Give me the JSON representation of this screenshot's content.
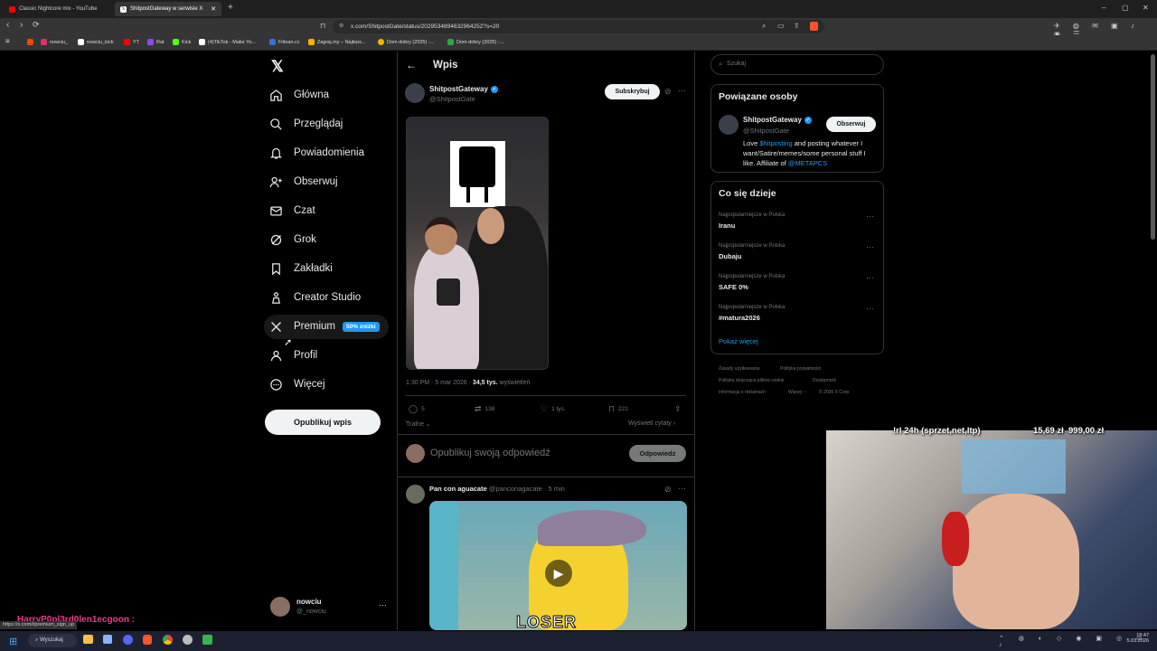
{
  "tabs": [
    {
      "title": "Classic Nightcore mix - YouTube",
      "color": "#ff0000"
    },
    {
      "title": "ShitpostGateway w serwisie X",
      "color": "#ffffff"
    }
  ],
  "new_tab": "+",
  "window": {
    "minimize": "–",
    "maximize": "▢",
    "close": "✕"
  },
  "address_bar": {
    "url": "x.com/ShitpostGate/status/2029534894632964252?s=20"
  },
  "bookmarks": [
    {
      "label": "",
      "color": "#ff4500"
    },
    {
      "label": "nowciu_",
      "color": "#e1306c"
    },
    {
      "label": "nowciu_kick",
      "color": "#ffffff"
    },
    {
      "label": "YT",
      "color": "#ff0000"
    },
    {
      "label": "Rat",
      "color": "#9146ff"
    },
    {
      "label": "Kick",
      "color": "#53fc18"
    },
    {
      "label": "(4)TikTok - Make Yo...",
      "color": "#ffffff"
    },
    {
      "label": "Filman.cc",
      "color": "#3b6fd9"
    },
    {
      "label": "Zagraj.my – Najleps...",
      "color": "#f2b500"
    },
    {
      "label": "Dom dobry (2025) -...",
      "color": "#f2b500"
    },
    {
      "label": "Dom dobry (2025) -...",
      "color": "#2ca34a"
    }
  ],
  "nav": {
    "home": "Główna",
    "explore": "Przeglądaj",
    "notifications": "Powiadomienia",
    "follow": "Obserwuj",
    "chat": "Czat",
    "grok": "Grok",
    "bookmarks": "Zakładki",
    "creator": "Creator Studio",
    "premium": "Premium",
    "premium_badge": "50% zniżki",
    "profile": "Profil",
    "more": "Więcej",
    "post_button": "Opublikuj wpis"
  },
  "account": {
    "name": "nowciu",
    "handle": "@_nowciu"
  },
  "header": {
    "title": "Wpis"
  },
  "post": {
    "author": "ShitpostGateway",
    "handle": "@ShitpostGate",
    "subscribe": "Subskrybuj",
    "time": "1:30 PM · 5 mar 2026 · ",
    "views": "34,5 tys.",
    "views_label": " wyświetleń",
    "replies": "5",
    "reposts": "138",
    "likes": "1 tys.",
    "bookmarks": "221",
    "sort": "Trafne",
    "quotes": "Wyświetl cytaty"
  },
  "reply": {
    "placeholder": "Opublikuj swoją odpowiedź",
    "button": "Odpowiedz"
  },
  "comment": {
    "author": "Pan con aguacate",
    "handle": "@panconagacate · 5 min",
    "gif_text": "LOSER"
  },
  "search": {
    "placeholder": "Szukaj"
  },
  "related": {
    "title": "Powiązane osoby",
    "name": "ShitpostGateway",
    "handle": "@ShitpostGate",
    "follow": "Obserwuj",
    "bio_1": "Love ",
    "bio_tag": "$hitposting",
    "bio_2": " and posting whatever I want/Satire/memes/some personal stuff I like. Affiliate of ",
    "bio_mention": "@METAPCS"
  },
  "trends": {
    "title": "Co się dzieje",
    "items": [
      {
        "meta": "Najpopularniejsze w Polska",
        "name": "Iranu"
      },
      {
        "meta": "Najpopularniejsze w Polska",
        "name": "Dubaju"
      },
      {
        "meta": "Najpopularniejsze w Polska",
        "name": "SAFE 0%"
      },
      {
        "meta": "Najpopularniejsze w Polska",
        "name": "#matura2026"
      }
    ],
    "show_more": "Pokaż więcej"
  },
  "footer": {
    "terms": "Zasady użytkowania",
    "privacy": "Polityka prywatności",
    "cookies": "Polityka dotycząca plików cookie",
    "accessibility": "Dostępność",
    "ads": "Informacja o reklamach",
    "more": "Więcej ···",
    "copyright": "© 2026 X Corp."
  },
  "overlay": {
    "label": "!rl 24h (sprzet,net,ltp)",
    "price1": "15,69 zł",
    "price2": "999,00 zł"
  },
  "chat_overlay": {
    "name": "HarryP0pl3rd0len1ecgoon :"
  },
  "status_url": "https://x.com/i/premium_sign_up",
  "taskbar": {
    "search": "Wyszukaj",
    "time": "18:47",
    "date": "5.03.2026"
  }
}
